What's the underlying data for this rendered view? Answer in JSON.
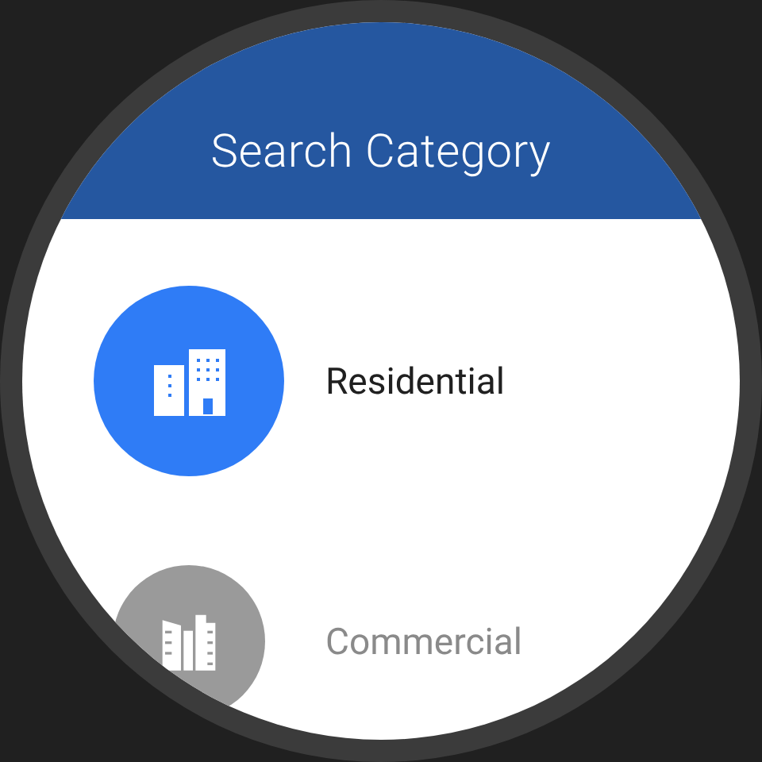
{
  "header": {
    "title": "Search Category"
  },
  "categories": [
    {
      "label": "Residential",
      "kind": "residential",
      "selected": true
    },
    {
      "label": "Commercial",
      "kind": "commercial",
      "selected": false
    }
  ]
}
